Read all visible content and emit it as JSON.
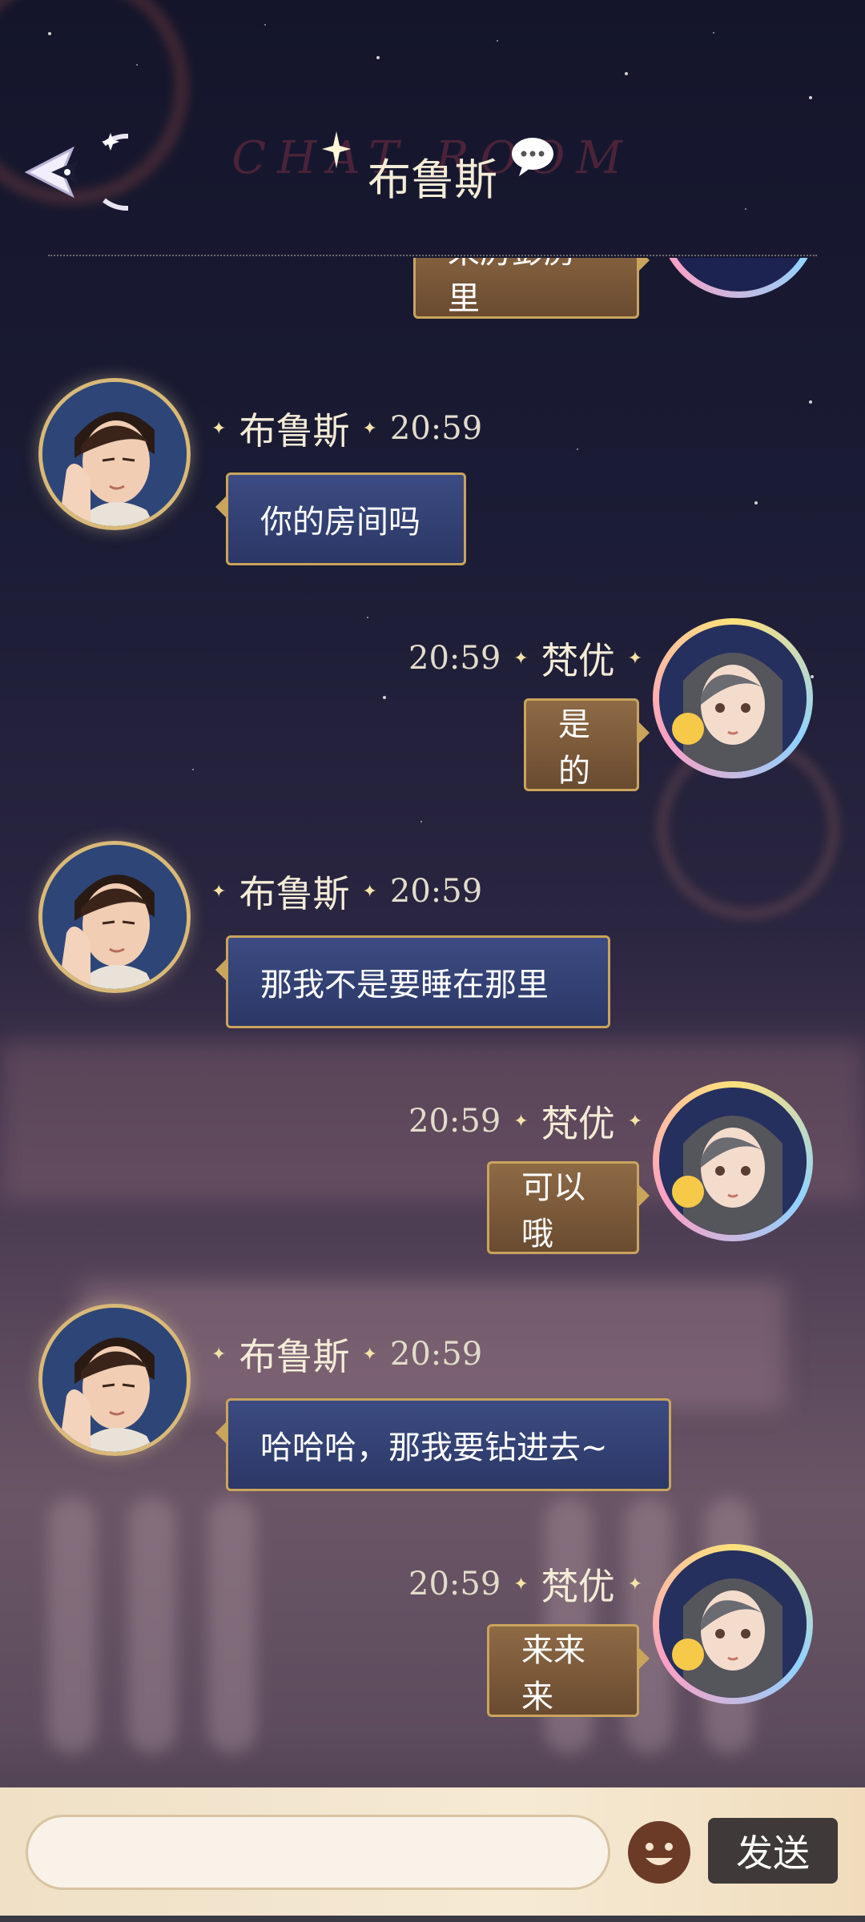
{
  "header": {
    "title": "布鲁斯",
    "decoration": "CHAT ROOM"
  },
  "messages": [
    {
      "side": "right",
      "text": "来厉彭房里",
      "partial": true
    },
    {
      "side": "left",
      "name": "布鲁斯",
      "time": "20:59",
      "text": "你的房间吗"
    },
    {
      "side": "right",
      "name": "梵优",
      "time": "20:59",
      "text": "是的"
    },
    {
      "side": "left",
      "name": "布鲁斯",
      "time": "20:59",
      "text": "那我不是要睡在那里"
    },
    {
      "side": "right",
      "name": "梵优",
      "time": "20:59",
      "text": "可以哦"
    },
    {
      "side": "left",
      "name": "布鲁斯",
      "time": "20:59",
      "text": "哈哈哈，那我要钻进去~"
    },
    {
      "side": "right",
      "name": "梵优",
      "time": "20:59",
      "text": "来来来"
    }
  ],
  "input": {
    "placeholder": "",
    "value": ""
  },
  "send_label": "发送",
  "colors": {
    "bubble_left": "#3c4b82",
    "bubble_right": "#8e6a45",
    "bubble_border": "#c9a45c",
    "name_text": "#f4ecd7",
    "send_button": "#3f3a39"
  },
  "icons": {
    "back": "back-arrow-icon",
    "title_bubble": "chat-bubble-icon",
    "emoji": "emoji-face-icon"
  }
}
